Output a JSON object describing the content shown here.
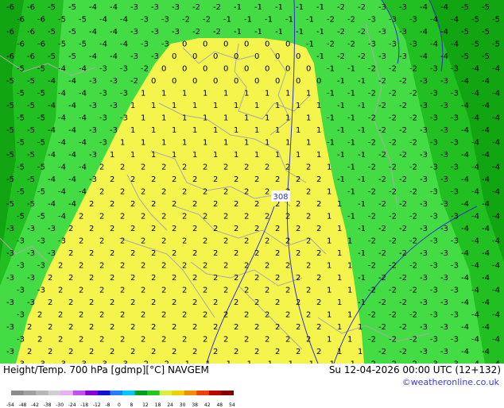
{
  "footer": {
    "left_label": "Height/Temp. 700 hPa [gdmp][°C] NAVGEM",
    "right_label": "Su 12-04-2026 00:00 UTC (12+132)",
    "credit": "©weatheronline.co.uk"
  },
  "map": {
    "contour_label": "308",
    "colors": {
      "zone_green_dark": "#11a611",
      "zone_green_mid": "#22bf22",
      "zone_green_light": "#44dc44",
      "zone_yellow": "#f4f44c",
      "borders": "#a9a9a9",
      "isoline": "#3030c8"
    }
  },
  "legend": {
    "ticks": [
      "-54",
      "-48",
      "-42",
      "-38",
      "-30",
      "-24",
      "-18",
      "-12",
      "-8",
      "0",
      "8",
      "12",
      "18",
      "24",
      "30",
      "38",
      "42",
      "48",
      "54"
    ],
    "colors": [
      "#8c8c8c",
      "#a0a0a0",
      "#b8b8b8",
      "#d0d0d0",
      "#e8b0f0",
      "#c050f0",
      "#8a00d8",
      "#1010d8",
      "#2080ff",
      "#00c8ff",
      "#00a020",
      "#20c820",
      "#d8f040",
      "#f0d000",
      "#f09000",
      "#f04000",
      "#c00000",
      "#800000"
    ]
  }
}
